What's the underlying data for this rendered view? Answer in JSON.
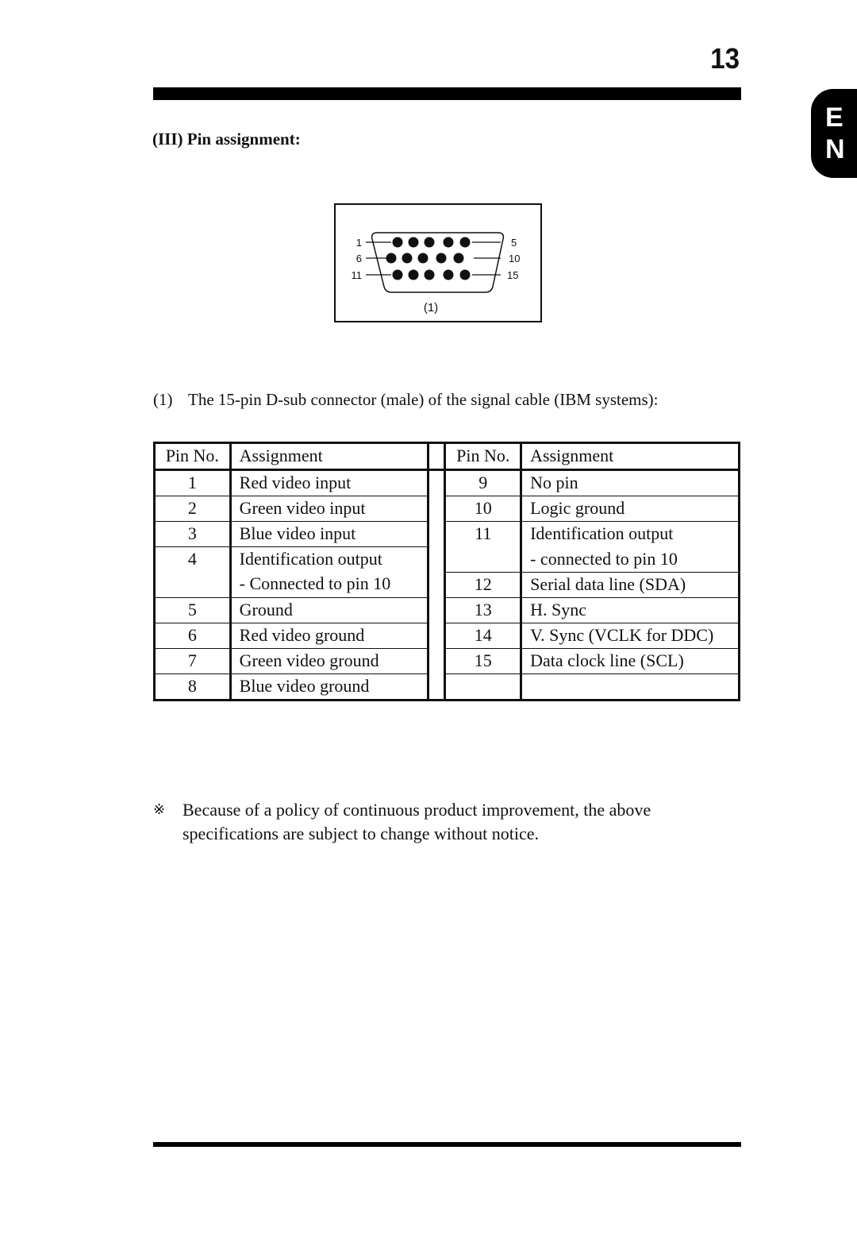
{
  "page": {
    "number": "13",
    "language_tab": [
      "E",
      "N"
    ]
  },
  "section": {
    "title": "(III) Pin assignment:"
  },
  "diagram": {
    "connector_label": "(1)",
    "pin_labels": {
      "row1_left": "1",
      "row1_right": "5",
      "row2_left": "6",
      "row2_right": "10",
      "row3_left": "11",
      "row3_right": "15"
    }
  },
  "caption": {
    "number": "(1)",
    "text": "The 15-pin D-sub connector (male) of the signal cable (IBM systems):"
  },
  "table": {
    "headers": {
      "pin_no": "Pin No.",
      "assignment": "Assignment"
    },
    "left": [
      {
        "pin": "1",
        "assignment": "Red video input"
      },
      {
        "pin": "2",
        "assignment": "Green video input"
      },
      {
        "pin": "3",
        "assignment": "Blue video input"
      },
      {
        "pin": "4",
        "assignment": "Identification output"
      },
      {
        "pin": "",
        "assignment": "- Connected to pin 10"
      },
      {
        "pin": "5",
        "assignment": "Ground"
      },
      {
        "pin": "6",
        "assignment": "Red video ground"
      },
      {
        "pin": "7",
        "assignment": "Green video ground"
      },
      {
        "pin": "8",
        "assignment": "Blue video ground"
      }
    ],
    "right": [
      {
        "pin": "9",
        "assignment": "No pin"
      },
      {
        "pin": "10",
        "assignment": "Logic ground"
      },
      {
        "pin": "11",
        "assignment": "Identification output"
      },
      {
        "pin": "",
        "assignment": "- connected to pin 10"
      },
      {
        "pin": "12",
        "assignment": "Serial data line (SDA)"
      },
      {
        "pin": "13",
        "assignment": "H. Sync"
      },
      {
        "pin": "14",
        "assignment": "V. Sync (VCLK for DDC)"
      },
      {
        "pin": "15",
        "assignment": "Data clock line (SCL)"
      },
      {
        "pin": "",
        "assignment": ""
      }
    ]
  },
  "note": {
    "mark": "※",
    "text": "Because of a policy of continuous product improvement, the above specifications are subject to change without notice."
  }
}
